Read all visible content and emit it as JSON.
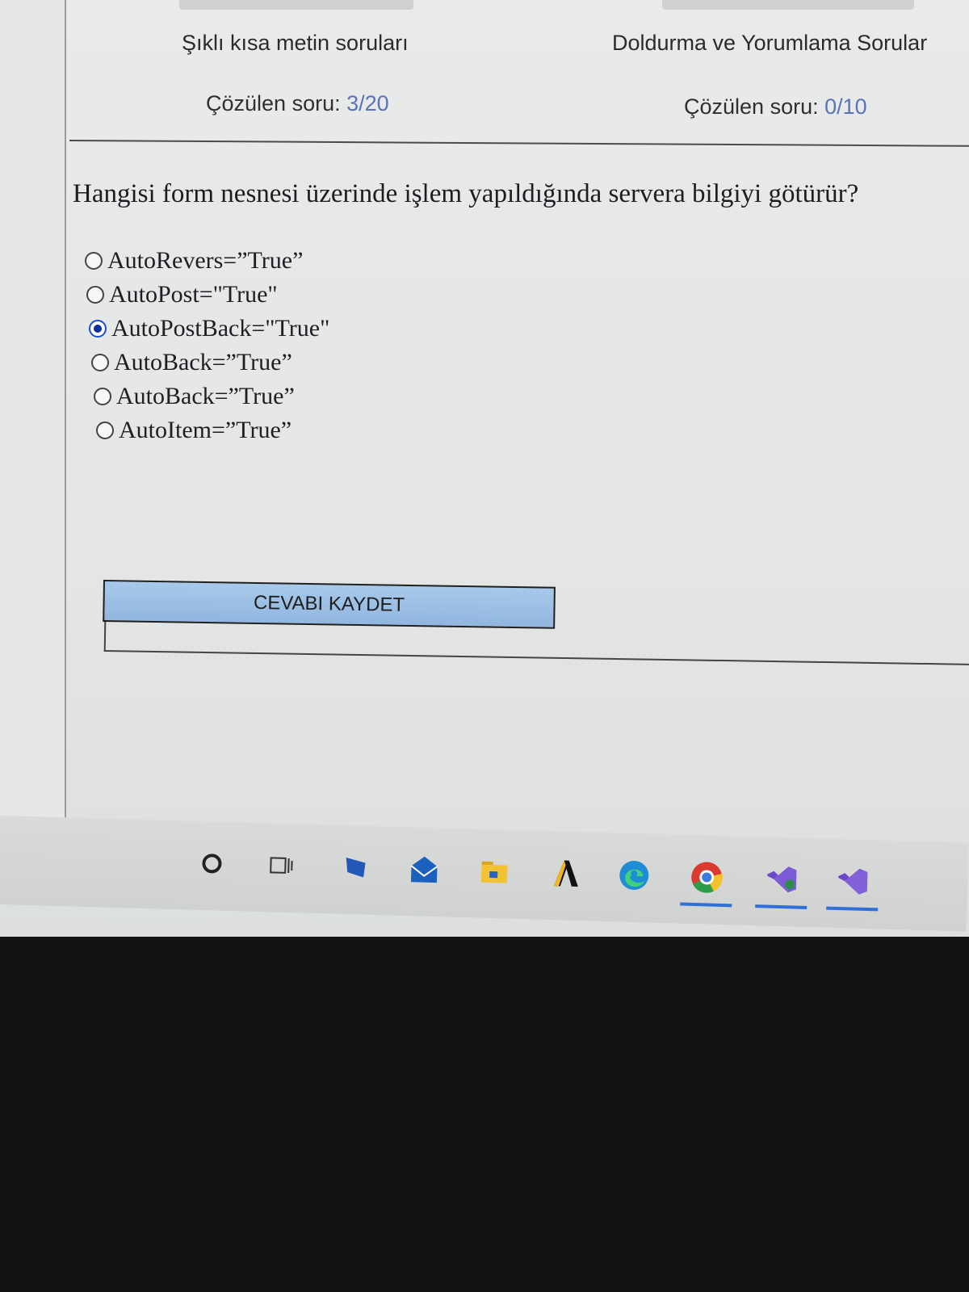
{
  "header": {
    "categories": [
      {
        "title": "Şıklı kısa metin soruları",
        "progress_label": "Çözülen soru:",
        "progress_value": "3/20"
      },
      {
        "title": "Doldurma ve Yorumlama Sorular",
        "progress_label": "Çözülen soru:",
        "progress_value": "0/10"
      }
    ]
  },
  "question": {
    "text": "Hangisi form nesnesi üzerinde işlem yapıldığında servera bilgiyi götürür?",
    "options": [
      {
        "label": "AutoRevers=”True”",
        "selected": false
      },
      {
        "label": "AutoPost=\"True\"",
        "selected": false
      },
      {
        "label": "AutoPostBack=\"True\"",
        "selected": true
      },
      {
        "label": "AutoBack=”True”",
        "selected": false
      },
      {
        "label": "AutoBack=”True”",
        "selected": false
      },
      {
        "label": "AutoItem=”True”",
        "selected": false
      }
    ]
  },
  "actions": {
    "save_label": "CEVABI KAYDET"
  },
  "taskbar": {
    "icons": [
      "search-icon",
      "task-view-icon",
      "file-explorer-icon",
      "mail-icon",
      "folder-icon",
      "app-a-icon",
      "edge-icon",
      "chrome-icon",
      "visual-studio-installer-icon",
      "visual-studio-icon"
    ]
  },
  "colors": {
    "progress_value": "#5a73b8",
    "button_fill": "#9dbfe5",
    "radio_selected": "#0c2f9a"
  }
}
